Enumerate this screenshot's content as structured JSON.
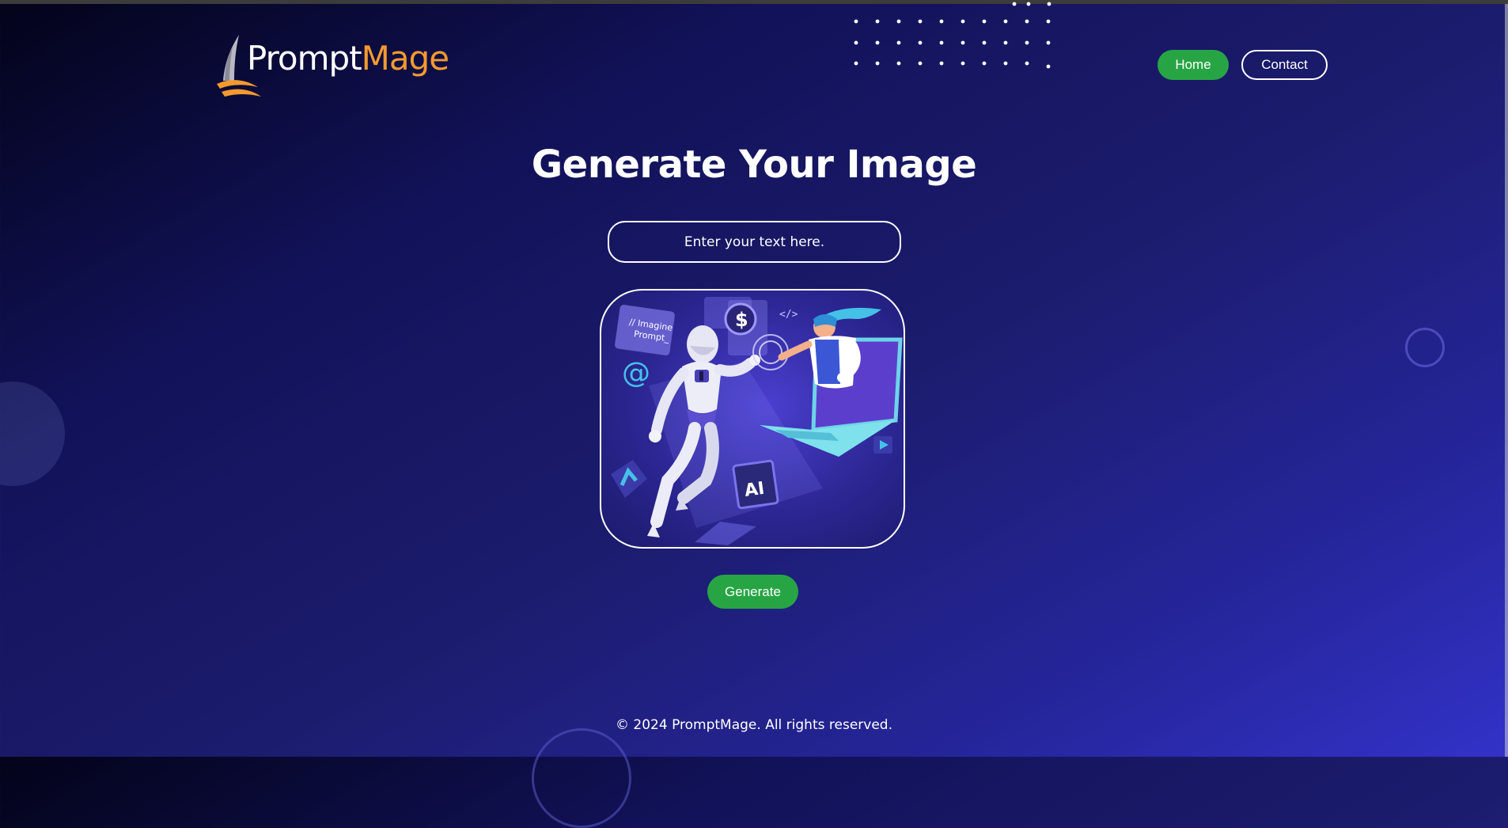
{
  "header": {
    "logo_part1": "Prompt",
    "logo_part2": "Mage",
    "nav": {
      "home_label": "Home",
      "contact_label": "Contact"
    }
  },
  "main": {
    "title": "Generate Your Image",
    "prompt_placeholder": "Enter your text here.",
    "illustration_text": {
      "note_line1": "// Imagine",
      "note_line2": "Prompt_",
      "code_tag": "</>",
      "chip_label": "AI",
      "coin_symbol": "$",
      "at_symbol": "@"
    },
    "generate_label": "Generate"
  },
  "footer": {
    "copyright": "© 2024 PromptMage. All rights reserved."
  },
  "colors": {
    "accent_green": "#27a544",
    "logo_orange": "#f39a2f",
    "background_dark": "#03031a",
    "background_light": "#3232c8"
  },
  "icons": [
    "logo-sail-icon",
    "robot-illustration",
    "coin-icon",
    "code-icon",
    "ai-chip-icon",
    "play-icon",
    "at-icon"
  ]
}
